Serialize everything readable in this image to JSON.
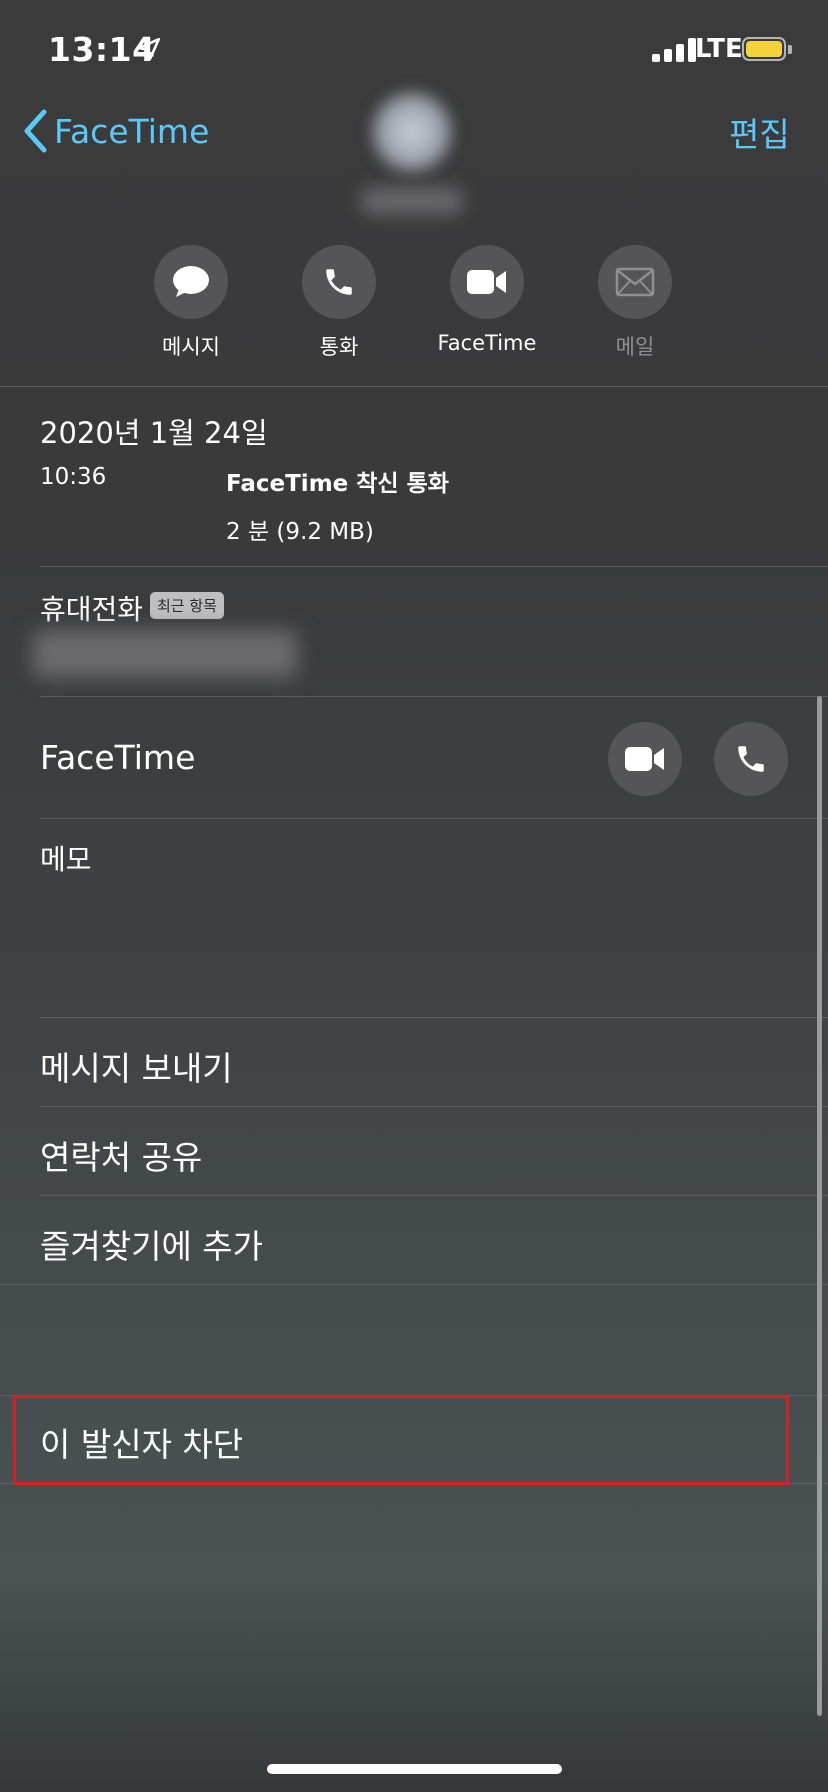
{
  "status_bar": {
    "time": "13:14",
    "network": "LTE",
    "battery_color": "#f5d33b"
  },
  "nav": {
    "back_label": "FaceTime",
    "edit_label": "편집"
  },
  "actions": [
    {
      "label": "메시지",
      "icon": "message-icon",
      "enabled": true
    },
    {
      "label": "통화",
      "icon": "phone-icon",
      "enabled": true
    },
    {
      "label": "FaceTime",
      "icon": "video-icon",
      "enabled": true
    },
    {
      "label": "메일",
      "icon": "mail-icon",
      "enabled": false
    }
  ],
  "call_log": {
    "date": "2020년 1월 24일",
    "time": "10:36",
    "type": "FaceTime 착신 통화",
    "detail": "2 분 (9.2 MB)"
  },
  "phone": {
    "label": "휴대전화",
    "badge": "최근 항목"
  },
  "facetime_row": {
    "label": "FaceTime"
  },
  "memo": {
    "label": "메모"
  },
  "options": {
    "send_message": "메시지 보내기",
    "share_contact": "연락처 공유",
    "add_favorite": "즐겨찾기에 추가",
    "block_caller": "이 발신자 차단"
  },
  "colors": {
    "accent": "#5ac8fa",
    "highlight_border": "#d0202a"
  }
}
